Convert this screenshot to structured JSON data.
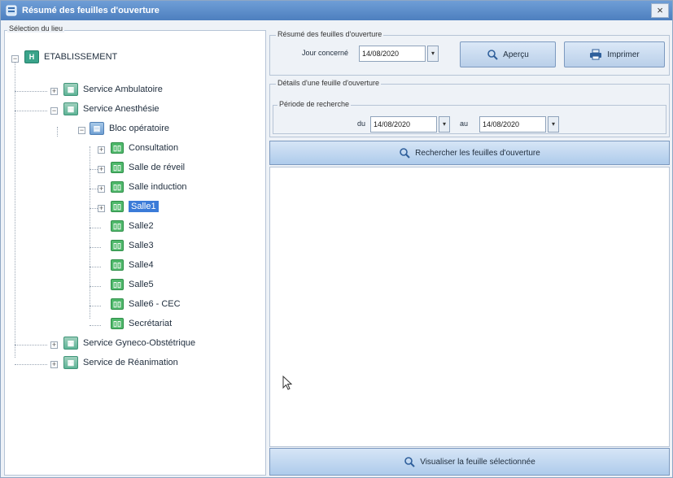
{
  "window": {
    "title": "Résumé des feuilles d'ouverture",
    "close_label": "×"
  },
  "left": {
    "legend": "Sélection du lieu",
    "tree": [
      {
        "label": "ETABLISSEMENT",
        "icon": "building-icon"
      },
      {
        "label": "Service Ambulatoire",
        "icon": "service-icon"
      },
      {
        "label": "Service Anesthésie",
        "icon": "service-icon"
      },
      {
        "label": "Bloc opératoire",
        "icon": "bloc-icon"
      },
      {
        "label": "Consultation",
        "icon": "room-icon"
      },
      {
        "label": "Salle de réveil",
        "icon": "room-icon"
      },
      {
        "label": "Salle induction",
        "icon": "room-icon"
      },
      {
        "label": "Salle1",
        "icon": "room-icon",
        "selected": true
      },
      {
        "label": "Salle2",
        "icon": "room-icon"
      },
      {
        "label": "Salle3",
        "icon": "room-icon"
      },
      {
        "label": "Salle4",
        "icon": "room-icon"
      },
      {
        "label": "Salle5",
        "icon": "room-icon"
      },
      {
        "label": "Salle6 - CEC",
        "icon": "room-icon"
      },
      {
        "label": "Secrétariat",
        "icon": "room-icon"
      },
      {
        "label": "Service Gyneco-Obstétrique",
        "icon": "service-icon"
      },
      {
        "label": "Service de Réanimation",
        "icon": "service-icon"
      }
    ]
  },
  "summary": {
    "legend": "Résumé des feuilles d'ouverture",
    "jour_label": "Jour concerné",
    "jour_value": "14/08/2020",
    "apercu_label": "Aperçu",
    "imprimer_label": "Imprimer"
  },
  "details": {
    "legend": "Détails d'une feuille d'ouverture",
    "periode_legend": "Période de recherche",
    "du_label": "du",
    "du_value": "14/08/2020",
    "au_label": "au",
    "au_value": "14/08/2020",
    "search_label": "Rechercher les feuilles d'ouverture",
    "view_label": "Visualiser la feuille sélectionnée"
  },
  "colors": {
    "accent": "#3b7bd8",
    "titlebar": "#4d7fbf",
    "room_green": "#4fb86b"
  }
}
